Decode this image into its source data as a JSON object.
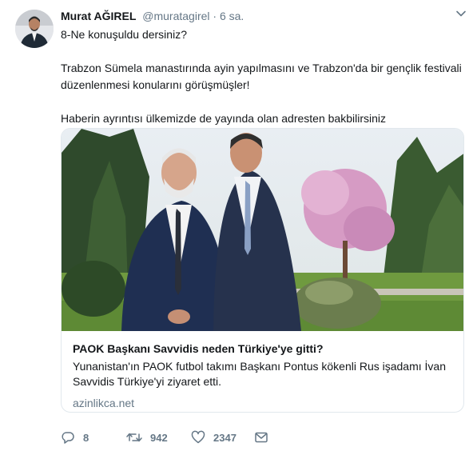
{
  "author": {
    "name": "Murat AĞIREL",
    "handle": "@muratagirel",
    "separator": "·",
    "time": "6 sa."
  },
  "tweet": {
    "line1": "8-Ne konuşuldu dersiniz?",
    "line2": "Trabzon Sümela manastırında ayin yapılmasını ve Trabzon'da bir gençlik festivali düzenlenmesi konularını görüşmüşler!",
    "line3": "Haberin ayrıntısı ülkemizde de yayında olan adresten bakbilirsiniz"
  },
  "card": {
    "title": "PAOK Başkanı Savvidis neden Türkiye'ye gitti?",
    "description": "Yunanistan'ın PAOK futbol takımı Başkanı Pontus kökenli Rus işadamı İvan Savvidis Türkiye'yi ziyaret etti.",
    "domain": "azinlikca.net"
  },
  "actions": {
    "replies": "8",
    "retweets": "942",
    "likes": "2347"
  },
  "icons": {
    "reply": "reply-icon",
    "retweet": "retweet-icon",
    "like": "heart-icon",
    "message": "envelope-icon",
    "more": "chevron-down-icon"
  },
  "colors": {
    "text": "#14171a",
    "muted": "#657786",
    "border": "#e1e8ed"
  }
}
